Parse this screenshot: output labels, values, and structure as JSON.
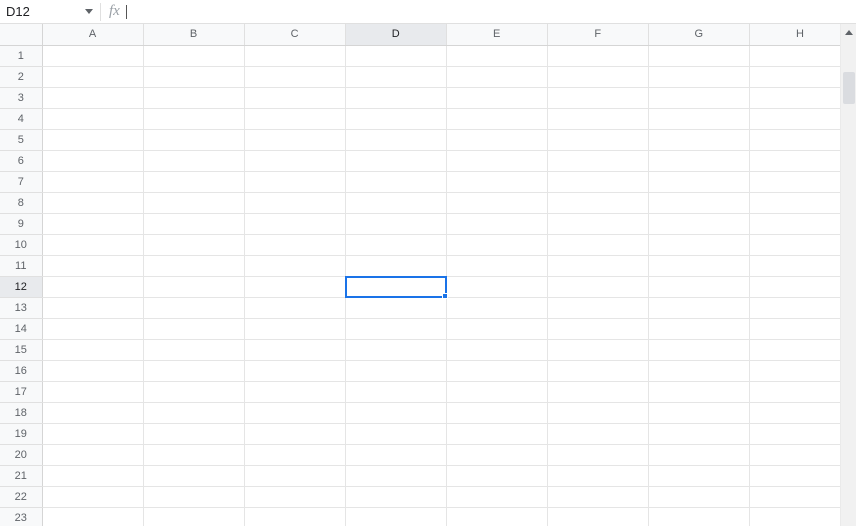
{
  "name_box": {
    "value": "D12"
  },
  "formula_bar": {
    "fx_label": "fx",
    "value": ""
  },
  "columns": [
    "A",
    "B",
    "C",
    "D",
    "E",
    "F",
    "G",
    "H"
  ],
  "rows": [
    "1",
    "2",
    "3",
    "4",
    "5",
    "6",
    "7",
    "8",
    "9",
    "10",
    "11",
    "12",
    "13",
    "14",
    "15",
    "16",
    "17",
    "18",
    "19",
    "20",
    "21",
    "22",
    "23"
  ],
  "active_cell": {
    "col": "D",
    "row": "12",
    "colIndex": 3,
    "rowIndex": 11
  },
  "cells": {}
}
